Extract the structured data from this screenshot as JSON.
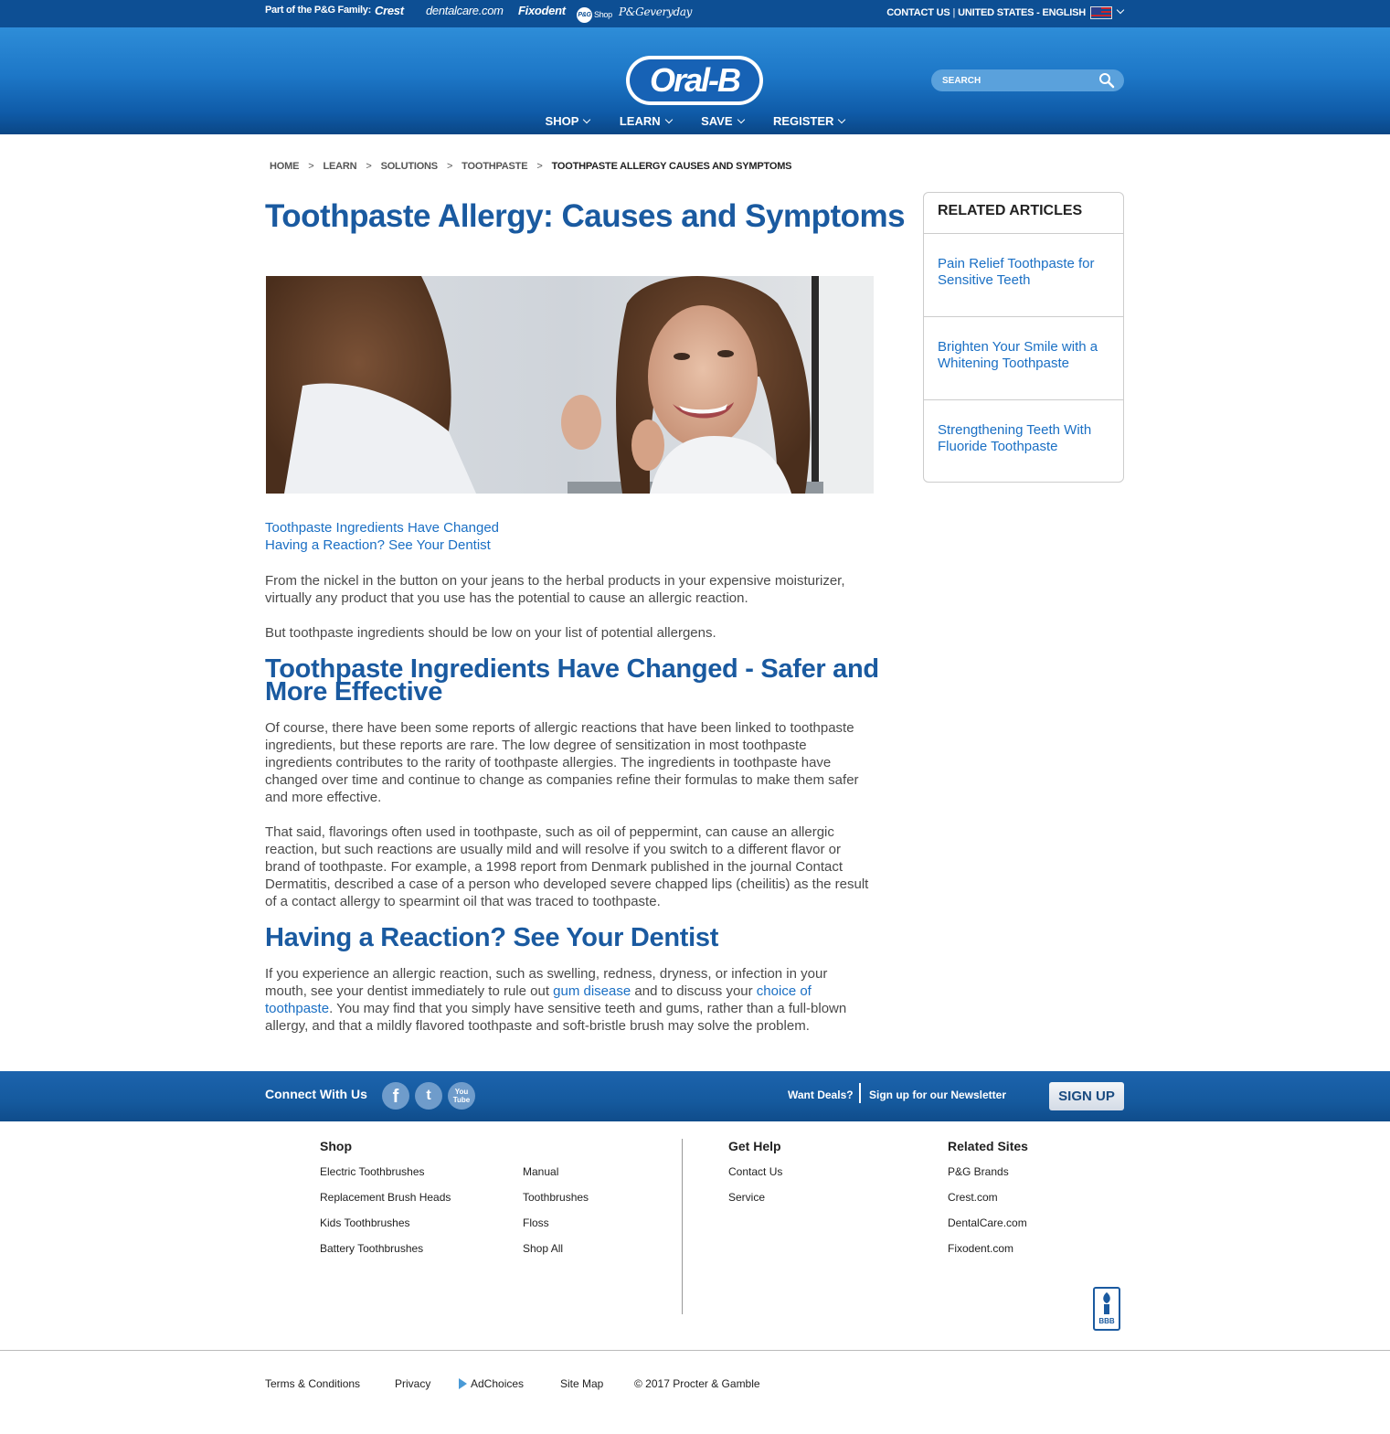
{
  "top_bar": {
    "family_label": "Part of the P&G Family:",
    "brands": [
      "Crest",
      "dentalcare.com",
      "Fixodent",
      "Shop",
      "P&Geveryday"
    ],
    "pg_shop_badge": "P&G",
    "contact_label": "CONTACT US",
    "separator": "|",
    "locale_label": "UNITED STATES - ENGLISH"
  },
  "header": {
    "logo_text": "Oral-B",
    "search_placeholder": "SEARCH",
    "nav": [
      "SHOP",
      "LEARN",
      "SAVE",
      "REGISTER"
    ]
  },
  "breadcrumb": [
    "HOME",
    "LEARN",
    "SOLUTIONS",
    "TOOTHPASTE",
    "TOOTHPASTE ALLERGY CAUSES AND SYMPTOMS"
  ],
  "breadcrumb_separator": ">",
  "article": {
    "title": "Toothpaste Allergy: Causes and Symptoms",
    "toc": [
      "Toothpaste Ingredients Have Changed",
      "Having a Reaction? See Your Dentist"
    ],
    "p1": "From the nickel in the button on your jeans to the herbal products in your expensive moisturizer, virtually any product that you use has the potential to cause an allergic reaction.",
    "p2": "But toothpaste ingredients should be low on your list of potential allergens.",
    "h2_1": "Toothpaste Ingredients Have Changed - Safer and More Effective",
    "p3": "Of course, there have been some reports of allergic reactions that have been linked to toothpaste ingredients, but these reports are rare. The low degree of sensitization in most toothpaste ingredients contributes to the rarity of toothpaste allergies. The ingredients in toothpaste have changed over time and continue to change as companies refine their formulas to make them safer and more effective.",
    "p4": "That said, flavorings often used in toothpaste, such as oil of peppermint, can cause an allergic reaction, but such reactions are usually mild and will resolve if you switch to a different flavor or brand of toothpaste. For example, a 1998 report from Denmark published in the journal Contact Dermatitis, described a case of a person who developed severe chapped lips (cheilitis) as the result of a contact allergy to spearmint oil that was traced to toothpaste.",
    "h2_2": "Having a Reaction? See Your Dentist",
    "p5_a": "If you experience an allergic reaction, such as swelling, redness, dryness, or infection in your mouth, see your dentist immediately to rule out ",
    "p5_link1": "gum disease",
    "p5_b": " and to discuss your ",
    "p5_link2": "choice of toothpaste",
    "p5_c": ". You may find that you simply have sensitive teeth and gums, rather than a full-blown allergy, and that a mildly flavored toothpaste and soft-bristle brush may solve the problem."
  },
  "related": {
    "heading": "RELATED ARTICLES",
    "items": [
      "Pain Relief Toothpaste for Sensitive Teeth",
      "Brighten Your Smile with a Whitening Toothpaste",
      "Strengthening Teeth With Fluoride Toothpaste"
    ]
  },
  "connect": {
    "label": "Connect With Us",
    "social": [
      "f",
      "t",
      "You Tube"
    ],
    "deals": "Want Deals?",
    "newsletter": "Sign up for our Newsletter",
    "signup": "SIGN UP"
  },
  "footer": {
    "shop_heading": "Shop",
    "shop_col1": [
      "Electric Toothbrushes",
      "Replacement Brush Heads",
      "Kids Toothbrushes",
      "Battery Toothbrushes"
    ],
    "shop_col2": [
      "Manual",
      "Toothbrushes",
      "Floss",
      "Shop All"
    ],
    "help_heading": "Get Help",
    "help_links": [
      "Contact Us",
      "Service"
    ],
    "related_heading": "Related Sites",
    "related_links": [
      "P&G Brands",
      "Crest.com",
      "DentalCare.com",
      "Fixodent.com"
    ],
    "bbb_label": "BBB",
    "legal": [
      "Terms & Conditions",
      "Privacy",
      "AdChoices",
      "Site Map",
      "© 2017 Procter & Gamble"
    ]
  },
  "colors": {
    "brand_blue": "#1a5aa0",
    "link_blue": "#1a6fc4",
    "top_bar": "#0d4f94"
  }
}
